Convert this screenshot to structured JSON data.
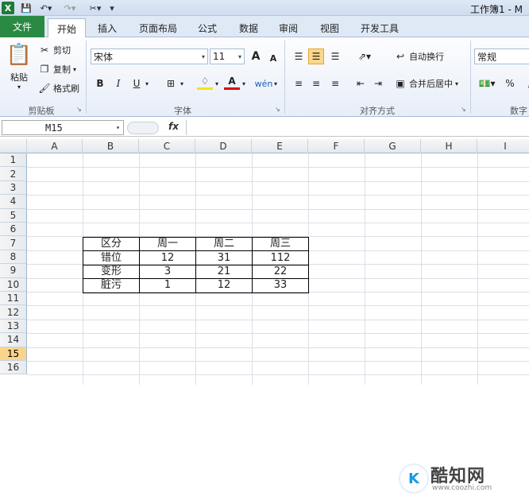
{
  "window": {
    "title": "工作簿1 - M"
  },
  "qat": {
    "app_icon": "X",
    "icons": [
      "excel-icon",
      "save-icon",
      "undo-icon",
      "redo-icon",
      "tools-icon",
      "customize-icon"
    ]
  },
  "tabs": [
    "文件",
    "开始",
    "插入",
    "页面布局",
    "公式",
    "数据",
    "审阅",
    "视图",
    "开发工具"
  ],
  "clipboard": {
    "paste": "粘贴",
    "cut": "剪切",
    "copy": "复制",
    "format_painter": "格式刷",
    "group": "剪贴板"
  },
  "font": {
    "name": "宋体",
    "size": "11",
    "group": "字体",
    "bold": "B",
    "italic": "I",
    "underline": "U",
    "grow": "A",
    "shrink": "A"
  },
  "alignment": {
    "wrap": "自动换行",
    "merge": "合并后居中",
    "group": "对齐方式"
  },
  "number": {
    "format": "常规",
    "group": "数字",
    "percent": "%"
  },
  "formula_bar": {
    "name_box": "M15",
    "fx": "fx",
    "formula": ""
  },
  "sheet": {
    "columns": [
      "A",
      "B",
      "C",
      "D",
      "E",
      "F",
      "G",
      "H",
      "I"
    ],
    "rows": [
      "1",
      "2",
      "3",
      "4",
      "5",
      "6",
      "7",
      "8",
      "9",
      "10",
      "11",
      "12",
      "13",
      "14",
      "15",
      "16"
    ],
    "selected_row": "15",
    "table": [
      [
        "区分",
        "周一",
        "周二",
        "周三"
      ],
      [
        "错位",
        "12",
        "31",
        "112"
      ],
      [
        "变形",
        "3",
        "21",
        "22"
      ],
      [
        "脏污",
        "1",
        "12",
        "33"
      ]
    ]
  },
  "watermark": {
    "logo": "K",
    "name": "酷知网",
    "url": "www.coozhi.com"
  }
}
